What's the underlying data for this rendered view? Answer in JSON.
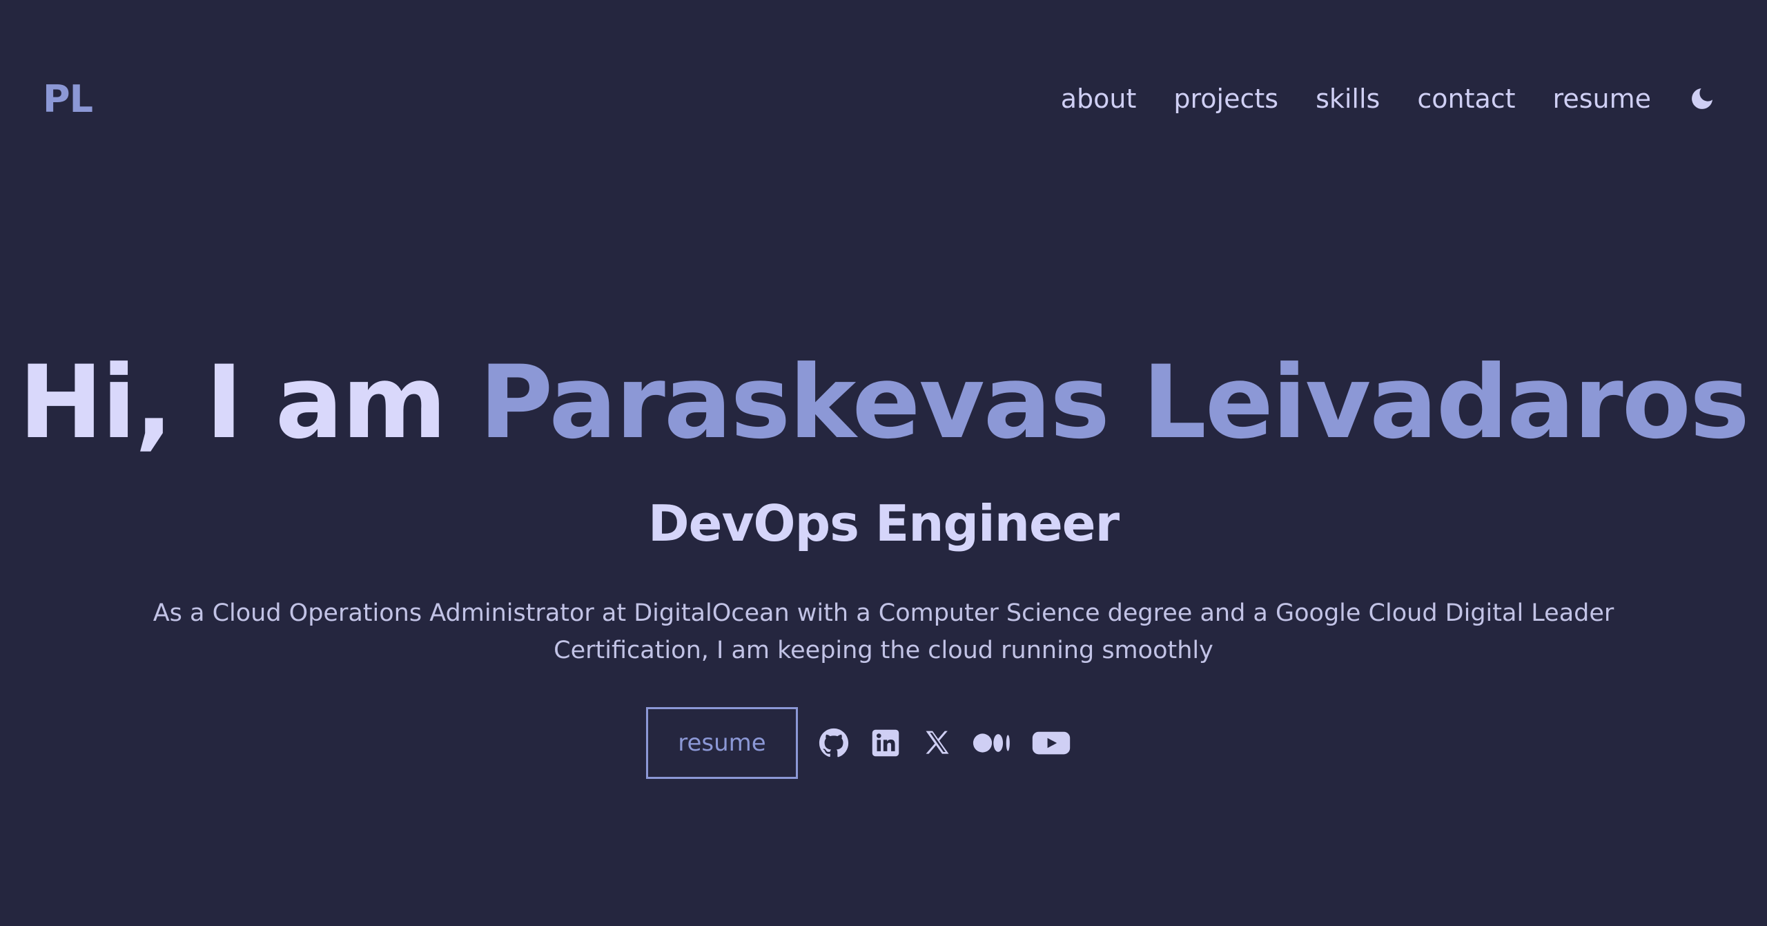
{
  "header": {
    "logo": "PL",
    "nav": [
      {
        "label": "about"
      },
      {
        "label": "projects"
      },
      {
        "label": "skills"
      },
      {
        "label": "contact"
      },
      {
        "label": "resume"
      }
    ],
    "theme_toggle_icon": "moon-icon"
  },
  "hero": {
    "greeting": "Hi, I am",
    "name": "Paraskevas Leivadaros",
    "role": "DevOps Engineer",
    "bio": "As a Cloud Operations Administrator at DigitalOcean with a Computer Science degree and a Google Cloud Digital Leader Certification, I am keeping the cloud running smoothly",
    "resume_button": "resume",
    "social_icons": [
      "github-icon",
      "linkedin-icon",
      "x-icon",
      "medium-icon",
      "youtube-icon"
    ]
  },
  "colors": {
    "background": "#25263f",
    "accent": "#8c98d6",
    "text": "#d9d8fb"
  }
}
